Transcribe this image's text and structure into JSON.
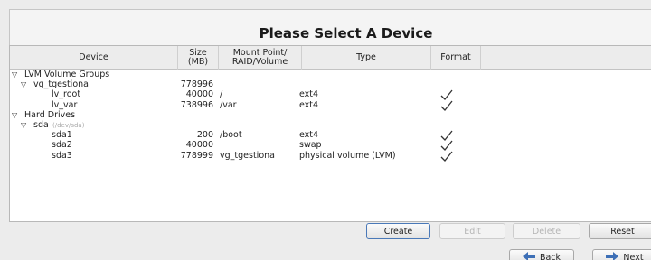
{
  "header": {
    "title": "Please Select A Device"
  },
  "columns": {
    "device": "Device",
    "size": "Size\n(MB)",
    "mount": "Mount Point/\nRAID/Volume",
    "type": "Type",
    "format": "Format"
  },
  "rows": [
    {
      "indent": 0,
      "expander": true,
      "name": "LVM Volume Groups",
      "path": "",
      "size": "",
      "mount": "",
      "type": "",
      "format": false
    },
    {
      "indent": 1,
      "expander": true,
      "name": "vg_tgestiona",
      "path": "",
      "size": "778996",
      "mount": "",
      "type": "",
      "format": false
    },
    {
      "indent": 2,
      "expander": false,
      "name": "lv_root",
      "path": "",
      "size": "40000",
      "mount": "/",
      "type": "ext4",
      "format": true
    },
    {
      "indent": 2,
      "expander": false,
      "name": "lv_var",
      "path": "",
      "size": "738996",
      "mount": "/var",
      "type": "ext4",
      "format": true
    },
    {
      "indent": 0,
      "expander": true,
      "name": "Hard Drives",
      "path": "",
      "size": "",
      "mount": "",
      "type": "",
      "format": false
    },
    {
      "indent": 1,
      "expander": true,
      "name": "sda",
      "path": "(/dev/sda)",
      "size": "",
      "mount": "",
      "type": "",
      "format": false
    },
    {
      "indent": 2,
      "expander": false,
      "name": "sda1",
      "path": "",
      "size": "200",
      "mount": "/boot",
      "type": "ext4",
      "format": true
    },
    {
      "indent": 2,
      "expander": false,
      "name": "sda2",
      "path": "",
      "size": "40000",
      "mount": "",
      "type": "swap",
      "format": true
    },
    {
      "indent": 2,
      "expander": false,
      "name": "sda3",
      "path": "",
      "size": "778999",
      "mount": "vg_tgestiona",
      "type": "physical volume (LVM)",
      "format": true
    }
  ],
  "actions": {
    "create": "Create",
    "edit": "Edit",
    "delete": "Delete",
    "reset": "Reset"
  },
  "nav": {
    "back": "Back",
    "next": "Next"
  },
  "icons": {
    "expander": "expander-triangle-icon",
    "check": "checkmark-icon",
    "back": "back-arrow-icon",
    "next": "next-arrow-icon"
  },
  "colors": {
    "arrow": "#3d6fb6",
    "check": "#333333"
  }
}
